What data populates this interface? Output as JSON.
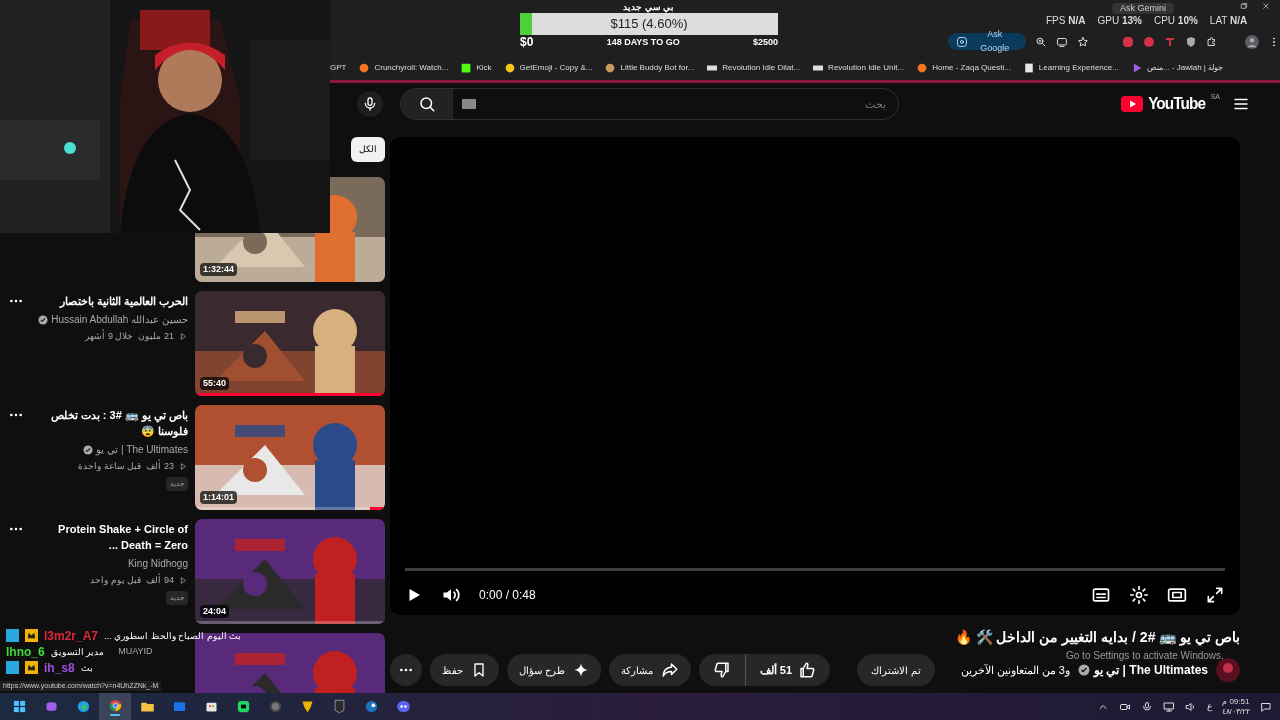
{
  "stream_overlay": {
    "goal_title": "بي سي جديد",
    "goal_amount": "$115 (4.60%)",
    "level": 0.046,
    "start": "$0",
    "days_left": "148 DAYS TO GO",
    "target": "$2500"
  },
  "stats": [
    "LAT **N/A**",
    "CPU **10%**",
    "GPU **13%**",
    "FPS **N/A**"
  ],
  "gemini_button": "Ask Gemini",
  "browser": {
    "ask_google": "Ask Google",
    "bookmarks": [
      {
        "label": "منص... - Jawlah | جولة",
        "kind": "play"
      },
      {
        "label": "Learning Experience...",
        "kind": "doc"
      },
      {
        "label": "Home - Zaqa Questi...",
        "kind": "orange"
      },
      {
        "label": "Revolution Idle Unit...",
        "kind": "gu"
      },
      {
        "label": "Revolution Idle Dilat...",
        "kind": "gu"
      },
      {
        "label": "Little Buddy Bot for...",
        "kind": "bot"
      },
      {
        "label": "GetEmoji - Copy &...",
        "kind": "emoji"
      },
      {
        "label": "Kick",
        "kind": "green"
      },
      {
        "label": "Crunchyroll: Watch...",
        "kind": "orange"
      },
      {
        "label": "GPT",
        "kind": "plain"
      }
    ]
  },
  "youtube": {
    "search_placeholder": "بحث",
    "logo": "YouTube",
    "region": "SA",
    "chip": {
      "label": "الكل",
      "selected": true
    },
    "player": {
      "time": "0:00 / 0:48",
      "level": 0
    },
    "title": "باص تي يو 🚌 #2 / بدايه التغيير من الداخل 🛠️ 🔥",
    "channel": {
      "name": "The Ultimates | تي يو",
      "verified": true,
      "collaborators": "و3 من المتعاونين الآخرين"
    },
    "subscribe": "تم الاشتراك",
    "likes": "51 ألف",
    "share": "مشاركة",
    "ask": "طرح سؤال",
    "save": "حفظ"
  },
  "recommendations": [
    {
      "duration": "1:32:44"
    },
    {
      "title": "الحرب العالمية الثانية باختصار",
      "channel": "حسين عبدالله Hussain Abdullah",
      "verified": true,
      "views": "21 مليون",
      "age": "خلال 9 أشهر",
      "duration": "55:40",
      "level": 1
    },
    {
      "title": "باص تي يو 🚌 #3 : بدت تخلص فلوسنا 😨",
      "channel": "The Ultimates | تي يو",
      "verified": true,
      "views": "23 ألف",
      "age": "قبل ساعة واحدة",
      "badge": "جديد",
      "duration": "1:14:01",
      "level": 0.08
    },
    {
      "title": "Protein Shake + Circle of Death = Zero ...",
      "channel": "King Nidhogg",
      "verified": false,
      "views": "94 ألف",
      "age": "قبل يوم واحد",
      "badge": "جديد",
      "duration": "24:04",
      "level": 0
    }
  ],
  "chat_overlay": [
    {
      "user": "l3m2r_A7",
      "color": "#e0283c",
      "message": "بث اليوم الصباح والحظ اسطوري ..."
    },
    {
      "user": "Ihno_6",
      "color": "#3ddc3d",
      "message": "مدير التسويق"
    },
    {
      "user": "ih_s8",
      "color": "#a050e0",
      "message": "بث"
    }
  ],
  "overlay_caption": "MUAYID",
  "status_url": "https://www.youtube.com/watch?v=n4UhZZNk_-M",
  "activation_notice": "Go to Settings to activate Windows.",
  "taskbar": {
    "apps": [
      {
        "kind": "windows",
        "selected": false
      },
      {
        "kind": "copilot",
        "selected": false
      },
      {
        "kind": "edge",
        "selected": false
      },
      {
        "kind": "chrome",
        "selected": true
      },
      {
        "kind": "folder",
        "selected": false
      },
      {
        "kind": "mail",
        "selected": false
      },
      {
        "kind": "store",
        "selected": false
      },
      {
        "kind": "chat",
        "selected": false
      },
      {
        "kind": "disc",
        "selected": false
      },
      {
        "kind": "shield",
        "selected": false
      },
      {
        "kind": "epic",
        "selected": false
      },
      {
        "kind": "steam",
        "selected": false
      },
      {
        "kind": "discord",
        "selected": false
      }
    ],
    "language": "ع",
    "time": "09:51 م",
    "date": "٤٨/٠٣/٢٢"
  }
}
